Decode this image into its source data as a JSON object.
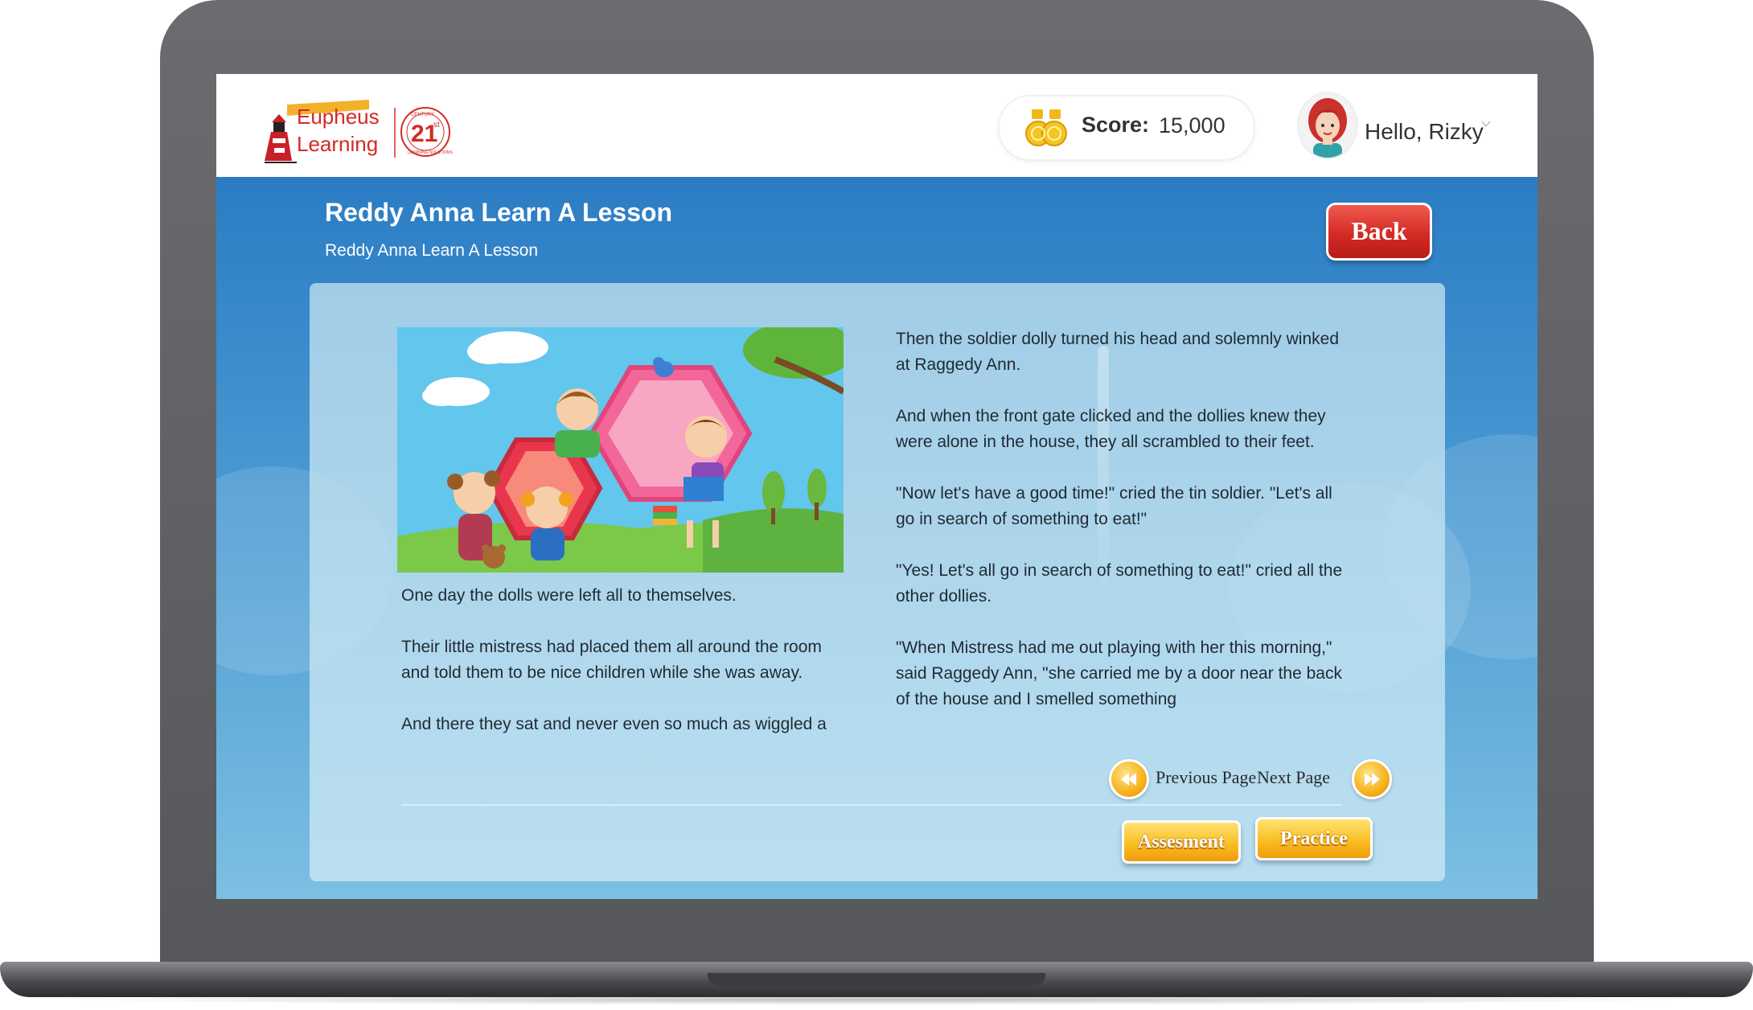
{
  "header": {
    "logo": {
      "line1": "Eupheus",
      "line2": "Learning",
      "badge_number": "21",
      "badge_superscript": "st",
      "badge_ring_top": "CENTURY",
      "badge_ring_bottom": "LEARNING SOLUTIONS"
    },
    "score": {
      "label": "Score:",
      "value": "15,000",
      "icon": "coins-icon"
    },
    "user": {
      "greeting": "Hello, Rizky",
      "avatar_icon": "girl-avatar-icon",
      "menu_icon": "chevron-down-icon"
    }
  },
  "lesson": {
    "title": "Reddy Anna Learn A Lesson",
    "subtitle": "Reddy Anna Learn A Lesson",
    "back_label": "Back"
  },
  "reader": {
    "illustration": "children-playing-illustration",
    "left_page": [
      "One day the dolls were left all to themselves.",
      "Their little mistress had placed them all around the room and told them to be nice children while she was away.",
      "And there they sat and never even so much as wiggled a"
    ],
    "right_page": [
      "Then the soldier dolly turned his head and solemnly winked at Raggedy Ann.",
      "And when the front gate clicked and the dollies knew they were alone in the house, they all scrambled to their feet.",
      "\"Now let's have a good time!\" cried the tin soldier. \"Let's all go in search of something to eat!\"",
      "\"Yes! Let's all go in search of something to eat!\" cried all the other dollies.",
      "\"When Mistress had me out playing with her this morning,\" said Raggedy Ann, \"she carried me by a door near the back of the house and I smelled something"
    ],
    "nav": {
      "previous_label": "Previous Page",
      "next_label": "Next Page"
    },
    "actions": {
      "assessment_label": "Assesment",
      "practice_label": "Practice"
    }
  },
  "colors": {
    "brand_red": "#d42a25",
    "brand_orange": "#f9be23",
    "background_blue": "#2f7fc4"
  }
}
